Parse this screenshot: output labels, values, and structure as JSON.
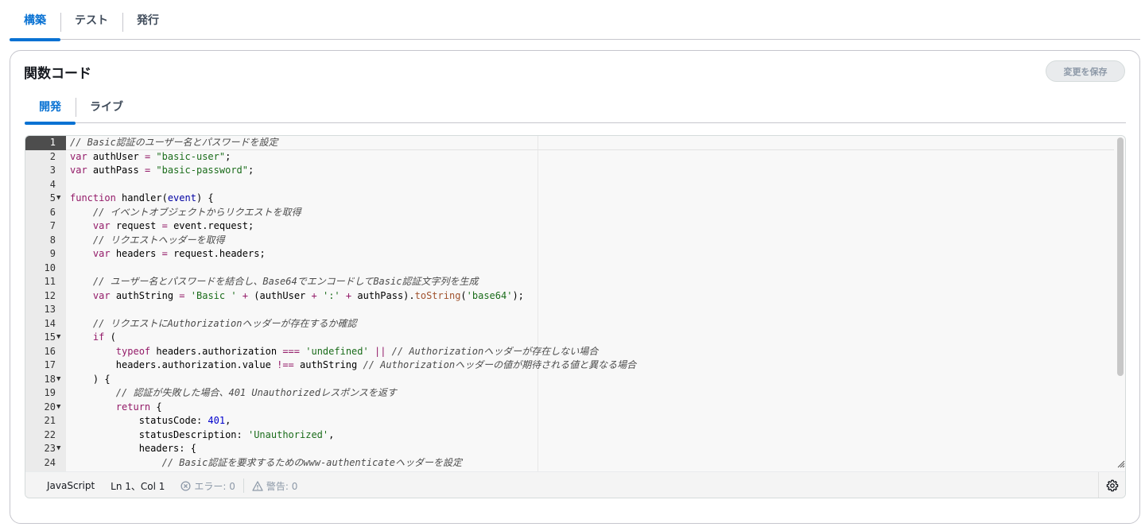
{
  "top_tabs": [
    {
      "label": "構築",
      "active": true
    },
    {
      "label": "テスト",
      "active": false
    },
    {
      "label": "発行",
      "active": false
    }
  ],
  "panel": {
    "title": "関数コード",
    "save_label": "変更を保存"
  },
  "inner_tabs": [
    {
      "label": "開発",
      "active": true
    },
    {
      "label": "ライブ",
      "active": false
    }
  ],
  "editor": {
    "active_line": 1,
    "lines": [
      {
        "n": "1",
        "fold": false
      },
      {
        "n": "2",
        "fold": false
      },
      {
        "n": "3",
        "fold": false
      },
      {
        "n": "4",
        "fold": false
      },
      {
        "n": "5",
        "fold": true
      },
      {
        "n": "6",
        "fold": false
      },
      {
        "n": "7",
        "fold": false
      },
      {
        "n": "8",
        "fold": false
      },
      {
        "n": "9",
        "fold": false
      },
      {
        "n": "10",
        "fold": false
      },
      {
        "n": "11",
        "fold": false
      },
      {
        "n": "12",
        "fold": false
      },
      {
        "n": "13",
        "fold": false
      },
      {
        "n": "14",
        "fold": false
      },
      {
        "n": "15",
        "fold": true
      },
      {
        "n": "16",
        "fold": false
      },
      {
        "n": "17",
        "fold": false
      },
      {
        "n": "18",
        "fold": true
      },
      {
        "n": "19",
        "fold": false
      },
      {
        "n": "20",
        "fold": true
      },
      {
        "n": "21",
        "fold": false
      },
      {
        "n": "22",
        "fold": false
      },
      {
        "n": "23",
        "fold": true
      },
      {
        "n": "24",
        "fold": false
      }
    ],
    "code": [
      [
        [
          "c",
          "// Basic認証のユーザー名とパスワードを設定"
        ]
      ],
      [
        [
          "k",
          "var"
        ],
        [
          "",
          " authUser "
        ],
        [
          "op",
          "="
        ],
        [
          "",
          " "
        ],
        [
          "s",
          "\"basic-user\""
        ],
        [
          "",
          ";"
        ]
      ],
      [
        [
          "k",
          "var"
        ],
        [
          "",
          " authPass "
        ],
        [
          "op",
          "="
        ],
        [
          "",
          " "
        ],
        [
          "s",
          "\"basic-password\""
        ],
        [
          "",
          ";"
        ]
      ],
      [],
      [
        [
          "k",
          "function"
        ],
        [
          "",
          " handler("
        ],
        [
          "kb",
          "event"
        ],
        [
          "",
          ") {"
        ]
      ],
      [
        [
          "",
          "    "
        ],
        [
          "c",
          "// イベントオブジェクトからリクエストを取得"
        ]
      ],
      [
        [
          "",
          "    "
        ],
        [
          "k",
          "var"
        ],
        [
          "",
          " request "
        ],
        [
          "op",
          "="
        ],
        [
          "",
          " event.request;"
        ]
      ],
      [
        [
          "",
          "    "
        ],
        [
          "c",
          "// リクエストヘッダーを取得"
        ]
      ],
      [
        [
          "",
          "    "
        ],
        [
          "k",
          "var"
        ],
        [
          "",
          " headers "
        ],
        [
          "op",
          "="
        ],
        [
          "",
          " request.headers;"
        ]
      ],
      [],
      [
        [
          "",
          "    "
        ],
        [
          "c",
          "// ユーザー名とパスワードを結合し、Base64でエンコードしてBasic認証文字列を生成"
        ]
      ],
      [
        [
          "",
          "    "
        ],
        [
          "k",
          "var"
        ],
        [
          "",
          " authString "
        ],
        [
          "op",
          "="
        ],
        [
          "",
          " "
        ],
        [
          "s",
          "'Basic '"
        ],
        [
          "",
          " "
        ],
        [
          "op",
          "+"
        ],
        [
          "",
          " (authUser "
        ],
        [
          "op",
          "+"
        ],
        [
          "",
          " "
        ],
        [
          "s",
          "':'"
        ],
        [
          "",
          " "
        ],
        [
          "op",
          "+"
        ],
        [
          "",
          " authPass)."
        ],
        [
          "f",
          "toString"
        ],
        [
          "",
          "("
        ],
        [
          "s",
          "'base64'"
        ],
        [
          "",
          ");"
        ]
      ],
      [],
      [
        [
          "",
          "    "
        ],
        [
          "c",
          "// リクエストにAuthorizationヘッダーが存在するか確認"
        ]
      ],
      [
        [
          "",
          "    "
        ],
        [
          "k",
          "if"
        ],
        [
          "",
          " ("
        ]
      ],
      [
        [
          "",
          "        "
        ],
        [
          "k",
          "typeof"
        ],
        [
          "",
          " headers.authorization "
        ],
        [
          "op",
          "==="
        ],
        [
          "",
          " "
        ],
        [
          "s",
          "'undefined'"
        ],
        [
          "",
          " "
        ],
        [
          "op",
          "||"
        ],
        [
          "",
          " "
        ],
        [
          "c",
          "// Authorizationヘッダーが存在しない場合"
        ]
      ],
      [
        [
          "",
          "        headers.authorization.value "
        ],
        [
          "op",
          "!=="
        ],
        [
          "",
          " authString "
        ],
        [
          "c",
          "// Authorizationヘッダーの値が期待される値と異なる場合"
        ]
      ],
      [
        [
          "",
          "    ) {"
        ]
      ],
      [
        [
          "",
          "        "
        ],
        [
          "c",
          "// 認証が失敗した場合、401 Unauthorizedレスポンスを返す"
        ]
      ],
      [
        [
          "",
          "        "
        ],
        [
          "k",
          "return"
        ],
        [
          "",
          " {"
        ]
      ],
      [
        [
          "",
          "            statusCode: "
        ],
        [
          "n",
          "401"
        ],
        [
          "",
          ","
        ]
      ],
      [
        [
          "",
          "            statusDescription: "
        ],
        [
          "s",
          "'Unauthorized'"
        ],
        [
          "",
          ","
        ]
      ],
      [
        [
          "",
          "            headers: {"
        ]
      ],
      [
        [
          "",
          "                "
        ],
        [
          "c",
          "// Basic認証を要求するためのwww-authenticateヘッダーを設定"
        ]
      ]
    ]
  },
  "status": {
    "language": "JavaScript",
    "position": "Ln 1、Col 1",
    "errors": "エラー: 0",
    "warnings": "警告: 0"
  },
  "icons": {
    "error": "error-circle-icon",
    "warning": "warning-triangle-icon",
    "settings": "gear-icon",
    "resize": "resize-handle-icon"
  },
  "colors": {
    "accent": "#0972d3",
    "comment": "#4c4c4c",
    "keyword": "#931a68",
    "string": "#1a6c1a"
  }
}
